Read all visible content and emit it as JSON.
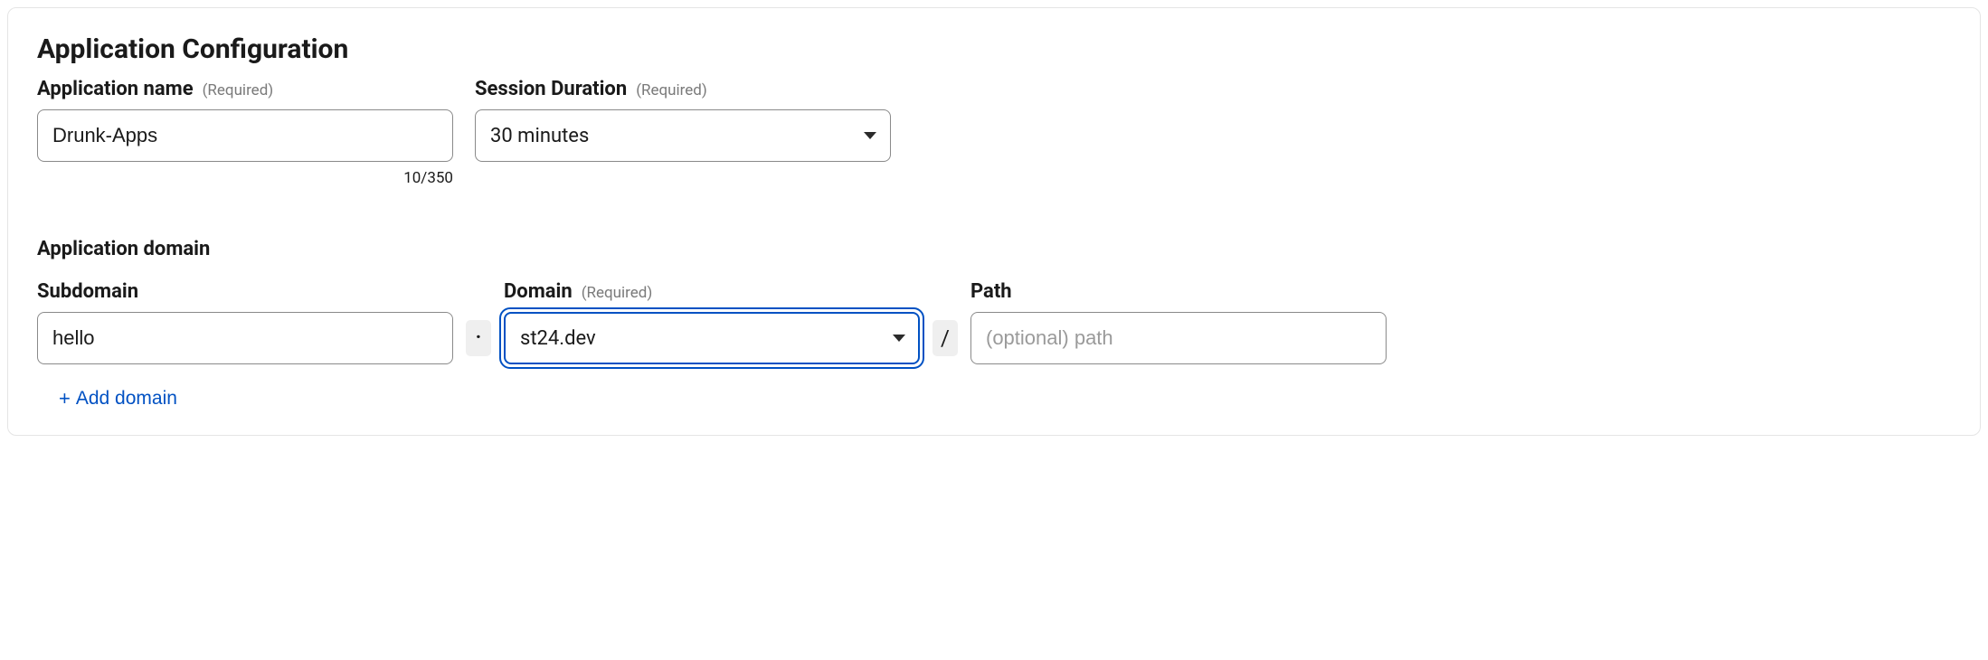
{
  "section_title": "Application Configuration",
  "app_name": {
    "label": "Application name",
    "required": "(Required)",
    "value": "Drunk-Apps",
    "counter": "10/350"
  },
  "session": {
    "label": "Session Duration",
    "required": "(Required)",
    "value": "30 minutes"
  },
  "app_domain_title": "Application domain",
  "subdomain": {
    "label": "Subdomain",
    "value": "hello"
  },
  "domain": {
    "label": "Domain",
    "required": "(Required)",
    "value": "st24.dev"
  },
  "path": {
    "label": "Path",
    "placeholder": "(optional) path",
    "value": ""
  },
  "separators": {
    "dot": "·",
    "slash": "/"
  },
  "add_domain_label": "Add domain"
}
